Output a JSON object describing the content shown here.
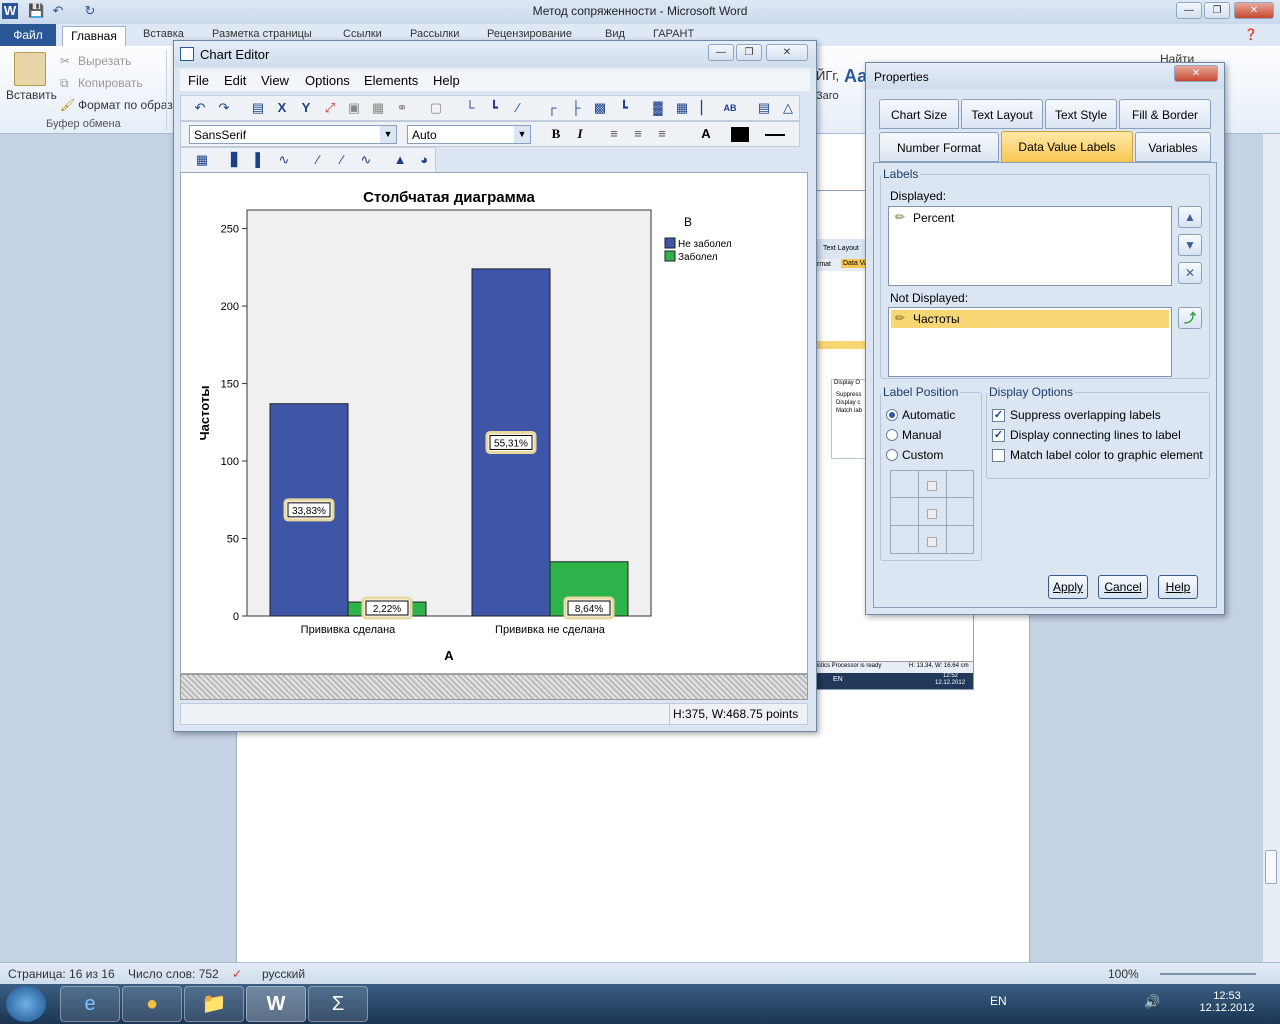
{
  "word": {
    "title": "Метод сопряженности  -  Microsoft Word",
    "file_tab": "Файл",
    "tabs": [
      "Главная",
      "Вставка",
      "Разметка страницы",
      "Ссылки",
      "Рассылки",
      "Рецензирование",
      "Вид",
      "ГАРАНТ"
    ],
    "ribbon": {
      "paste": "Вставить",
      "cut": "Вырезать",
      "copy": "Копировать",
      "format_painter": "Формат по образцу",
      "group_clipboard": "Буфер обмена",
      "style_sample": "Аа",
      "find": "Найти",
      "replace_sample": "Заго",
      "style_cut": "ЙГг,"
    },
    "status": {
      "page": "Страница: 16 из 16",
      "words": "Число слов: 752",
      "lang": "русский",
      "zoom": "100%"
    }
  },
  "taskbar": {
    "lang": "EN",
    "time": "12:53",
    "date": "12.12.2012"
  },
  "bgshot": {
    "tab1": "Text Layout",
    "tab2": "rmat",
    "tab3": "Data Va",
    "status": "tistics Processor is ready",
    "dims": "H: 13.34, W: 16.64 cm",
    "time": "12:52",
    "date": "12.12.2012",
    "lang": "EN",
    "opt_title": "Display O",
    "opt1": "Suppress",
    "opt2": "Display c",
    "opt3": "Match lab"
  },
  "chart_editor": {
    "title": "Chart Editor",
    "menu": [
      "File",
      "Edit",
      "View",
      "Options",
      "Elements",
      "Help"
    ],
    "font": "SansSerif",
    "size": "Auto",
    "bold": "B",
    "italic": "I",
    "status": "H:375, W:468.75 points"
  },
  "chart_data": {
    "type": "bar",
    "title": "Столбчатая диаграмма",
    "xlabel": "A",
    "ylabel": "Частоты",
    "legend_title": "B",
    "legend_position": "top-right",
    "categories": [
      "Прививка сделана",
      "Прививка не сделана"
    ],
    "series": [
      {
        "name": "Не заболел",
        "color": "#3f55a8",
        "values": [
          137,
          224
        ],
        "labels": [
          "33,83%",
          "55,31%"
        ]
      },
      {
        "name": "Заболел",
        "color": "#2db34a",
        "values": [
          9,
          35
        ],
        "labels": [
          "2,22%",
          "8,64%"
        ]
      }
    ],
    "ylim": [
      0,
      262
    ],
    "yticks": [
      0,
      50,
      100,
      150,
      200,
      250
    ],
    "grid": false
  },
  "properties": {
    "title": "Properties",
    "tabs_row1": [
      "Chart Size",
      "Text Layout",
      "Text Style",
      "Fill & Border"
    ],
    "tabs_row2": [
      "Number Format",
      "Data Value Labels",
      "Variables"
    ],
    "labels_legend": "Labels",
    "displayed_label": "Displayed:",
    "displayed_items": [
      "Percent"
    ],
    "not_displayed_label": "Not Displayed:",
    "not_displayed_items": [
      "Частоты"
    ],
    "label_position": "Label Position",
    "positions": [
      "Automatic",
      "Manual",
      "Custom"
    ],
    "selected_position": "Automatic",
    "display_options": "Display Options",
    "options": [
      {
        "label": "Suppress overlapping labels",
        "checked": true
      },
      {
        "label": "Display connecting lines to label",
        "checked": true
      },
      {
        "label": "Match label color to graphic element",
        "checked": false
      }
    ],
    "apply": "Apply",
    "cancel": "Cancel",
    "help": "Help"
  }
}
